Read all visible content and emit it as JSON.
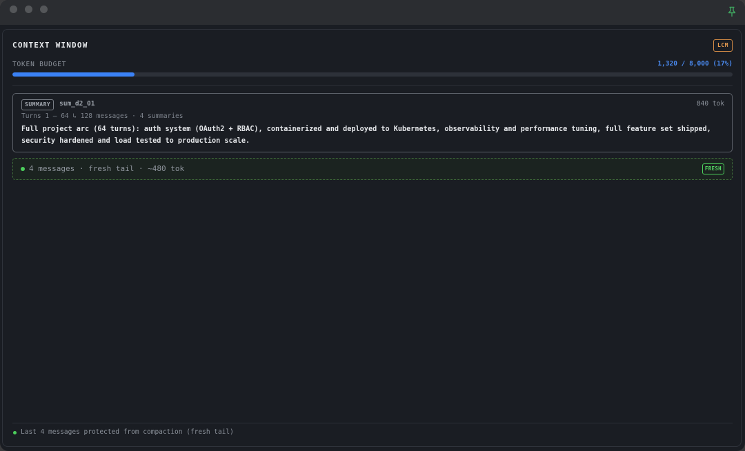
{
  "panel": {
    "title": "CONTEXT WINDOW",
    "mode_badge": "LCM"
  },
  "budget": {
    "label": "TOKEN BUDGET",
    "value_text": "1,320 / 8,000 (17%)",
    "used": 1320,
    "total": 8000,
    "fill_fraction": 0.17,
    "fill_color": "#3b82f6"
  },
  "summary": {
    "badge": "SUMMARY",
    "id": "sum_d2_01",
    "tokens": "840 tok",
    "meta": "Turns 1 – 64  ↳ 128 messages · 4 summaries",
    "text": "Full project arc (64 turns): auth system (OAuth2 + RBAC), containerized and deployed to Kubernetes, observability and performance tuning, full feature set shipped, security hardened and load tested to production scale."
  },
  "fresh_tail": {
    "text": "4 messages · fresh tail · ~480 tok",
    "badge": "FRESH",
    "color": "#4ccf5c"
  },
  "footer": {
    "text": "Last 4 messages protected from compaction (fresh tail)"
  },
  "titlebar": {
    "icons": [
      "close-icon",
      "minimize-icon",
      "zoom-icon",
      "pin-icon"
    ]
  }
}
